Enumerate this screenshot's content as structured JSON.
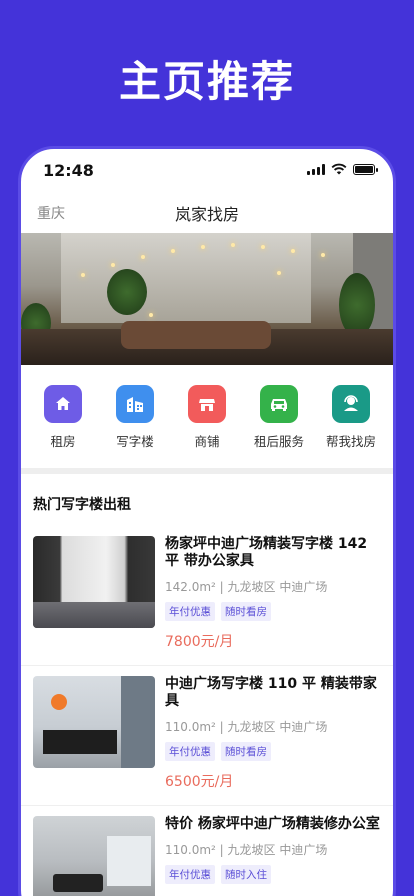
{
  "headline": "主页推荐",
  "status_bar": {
    "time": "12:48"
  },
  "nav": {
    "city": "重庆",
    "title": "岚家找房"
  },
  "categories": [
    {
      "label": "租房",
      "icon": "home-icon",
      "color": "#6e5ce6"
    },
    {
      "label": "写字楼",
      "icon": "building-icon",
      "color": "#3f8fee"
    },
    {
      "label": "商铺",
      "icon": "shop-icon",
      "color": "#f25b5b"
    },
    {
      "label": "租后服务",
      "icon": "car-icon",
      "color": "#34b24a"
    },
    {
      "label": "帮我找房",
      "icon": "agent-icon",
      "color": "#1a9a87"
    }
  ],
  "section_title": "热门写字楼出租",
  "listings": [
    {
      "title": "杨家坪中迪广场精装写字楼 142平 带办公家具",
      "meta": "142.0m² | 九龙坡区 中迪广场",
      "tags": [
        "年付优惠",
        "随时看房"
      ],
      "price": "7800元/月"
    },
    {
      "title": "中迪广场写字楼 110 平 精装带家具",
      "meta": "110.0m² | 九龙坡区 中迪广场",
      "tags": [
        "年付优惠",
        "随时看房"
      ],
      "price": "6500元/月"
    },
    {
      "title": "特价 杨家坪中迪广场精装修办公室",
      "meta": "110.0m² | 九龙坡区 中迪广场",
      "tags": [
        "年付优惠",
        "随时入住"
      ],
      "price": ""
    }
  ],
  "colors": {
    "brand": "#4433d9",
    "price": "#e96b5c",
    "tag_text": "#5a4ed6",
    "tag_bg": "#eeedfc"
  }
}
